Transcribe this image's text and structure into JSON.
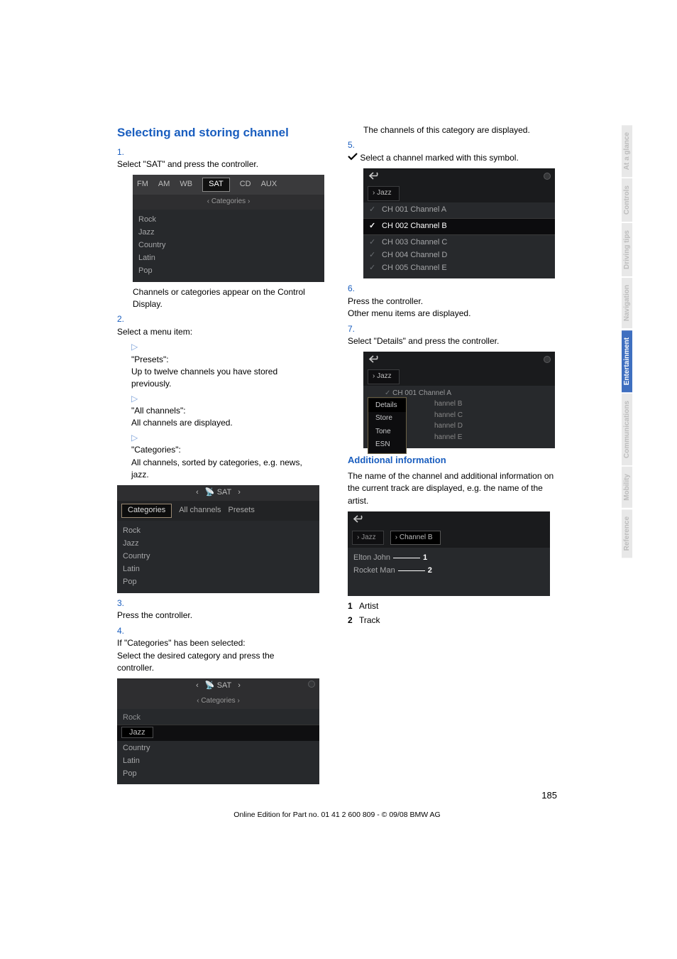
{
  "heading": "Selecting and storing channel",
  "step1": {
    "num": "1.",
    "text": "Select \"SAT\" and press the controller."
  },
  "shot1": {
    "bands": [
      "FM",
      "AM",
      "WB",
      "SAT",
      "CD",
      "AUX"
    ],
    "sub": "Categories",
    "rows": [
      "Rock",
      "Jazz",
      "Country",
      "Latin",
      "Pop"
    ]
  },
  "note1": "Channels or categories appear on the Control Display.",
  "step2": {
    "num": "2.",
    "text": "Select a menu item:"
  },
  "bullets2": {
    "b1": {
      "t": "\"Presets\":",
      "d": "Up to twelve channels you have stored previously."
    },
    "b2": {
      "t": "\"All channels\":",
      "d": "All channels are displayed."
    },
    "b3": {
      "t": "\"Categories\":",
      "d": "All channels, sorted by categories, e.g. news, jazz."
    }
  },
  "shot2": {
    "top": "SAT",
    "tabs": [
      "Categories",
      "All channels",
      "Presets"
    ],
    "rows": [
      "Rock",
      "Jazz",
      "Country",
      "Latin",
      "Pop"
    ]
  },
  "step3": {
    "num": "3.",
    "text": "Press the controller."
  },
  "step4": {
    "num": "4.",
    "text": "If \"Categories\" has been selected:",
    "text2": "Select the desired category and press the controller."
  },
  "shot3": {
    "top": "SAT",
    "sub": "Categories",
    "rows": [
      "Rock",
      "Jazz",
      "Country",
      "Latin",
      "Pop"
    ]
  },
  "rline1": "The channels of this category are displayed.",
  "step5": {
    "num": "5.",
    "text": "Select a channel marked with this symbol."
  },
  "shot4": {
    "crumb": "Jazz",
    "rows": [
      {
        "ch": "CH 001 Channel A",
        "sel": false
      },
      {
        "ch": "CH 002 Channel B",
        "sel": true
      },
      {
        "ch": "CH 003 Channel C",
        "sel": false
      },
      {
        "ch": "CH 004 Channel D",
        "sel": false
      },
      {
        "ch": "CH 005 Channel E",
        "sel": false
      }
    ]
  },
  "step6": {
    "num": "6.",
    "text": "Press the controller.",
    "text2": "Other menu items are displayed."
  },
  "step7": {
    "num": "7.",
    "text": "Select \"Details\" and press the controller."
  },
  "shot5": {
    "crumb": "Jazz",
    "top_row": "CH 001 Channel A",
    "menu": [
      "Details",
      "Store",
      "Tone",
      "ESN"
    ],
    "rows": [
      "hannel B",
      "hannel C",
      "hannel D",
      "hannel E"
    ]
  },
  "addl_h": "Additional information",
  "addl_p": "The name of the channel and additional information on the current track are displayed, e.g. the name of the artist.",
  "shot6": {
    "c1": "Jazz",
    "c2": "Channel B",
    "r1": "Elton John",
    "r2": "Rocket Man",
    "a1": "1",
    "a2": "2"
  },
  "legend": {
    "l1n": "1",
    "l1t": "Artist",
    "l2n": "2",
    "l2t": "Track"
  },
  "footer": {
    "page": "185",
    "line": "Online Edition for Part no. 01 41 2 600 809 - © 09/08 BMW AG"
  },
  "tabs": {
    "t1": "At a glance",
    "t2": "Controls",
    "t3": "Driving tips",
    "t4": "Navigation",
    "t5": "Entertainment",
    "t6": "Communications",
    "t7": "Mobility",
    "t8": "Reference"
  }
}
